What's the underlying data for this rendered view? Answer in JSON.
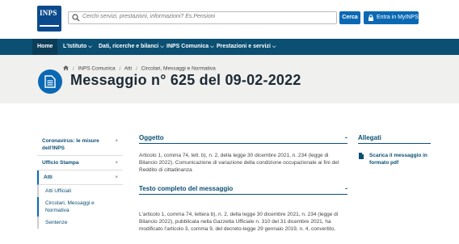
{
  "header": {
    "logo_text": "INPS",
    "search_placeholder": "Cerchi servizi, prestazioni, informazioni? Es.Pensioni",
    "search_button": "Cerca",
    "login_button": "Entra in MyINPS"
  },
  "nav": {
    "items": [
      {
        "label": "Home",
        "chevron": false
      },
      {
        "label": "L'Istituto",
        "chevron": true
      },
      {
        "label": "Dati, ricerche e bilanci",
        "chevron": true
      },
      {
        "label": "INPS Comunica",
        "chevron": true
      },
      {
        "label": "Prestazioni e servizi",
        "chevron": true
      }
    ]
  },
  "breadcrumb": {
    "items": [
      "INPS Comunica",
      "Atti",
      "Circolari, Messaggi e Normativa"
    ]
  },
  "page_title": "Messaggio n° 625 del 09-02-2022",
  "sidebar": {
    "items": [
      {
        "label": "Coronavirus: le misure dell'INPS",
        "toggle": "+"
      },
      {
        "label": "Ufficio Stampa",
        "toggle": "+"
      },
      {
        "label": "Atti",
        "toggle": "×"
      }
    ],
    "subitems": [
      "Atti Ufficiali",
      "Circolari, Messaggi e Normativa",
      "Sentenze"
    ]
  },
  "main": {
    "oggetto_title": "Oggetto",
    "oggetto_toggle": "-",
    "oggetto_text": "Articolo 1, comma 74, lett. b), n. 2, della legge 30 dicembre 2021, n. 234 (legge di Bilancio 2022). Comunicazione di variazione della condizione occupazionale ai fini del Reddito di cittadinanza",
    "testo_title": "Testo completo del messaggio",
    "testo_toggle": "-",
    "testo_text": "L'articolo 1, comma 74, lettera b), n. 2, della legge 30 dicembre 2021, n. 234 (legge di Bilancio 2022), pubblicata nella Gazzetta Ufficiale n. 310 del 31 dicembre 2021, ha modificato l'articolo 3, comma 9, del decreto-legge 29 gennaio 2019, n. 4, convertito,"
  },
  "allegati": {
    "title": "Allegati",
    "file_label": "Scarica il messaggio in formato pdf"
  },
  "colors": {
    "brand": "#0b4a8c",
    "nav": "#0b4f73",
    "button": "#0b69b4"
  }
}
